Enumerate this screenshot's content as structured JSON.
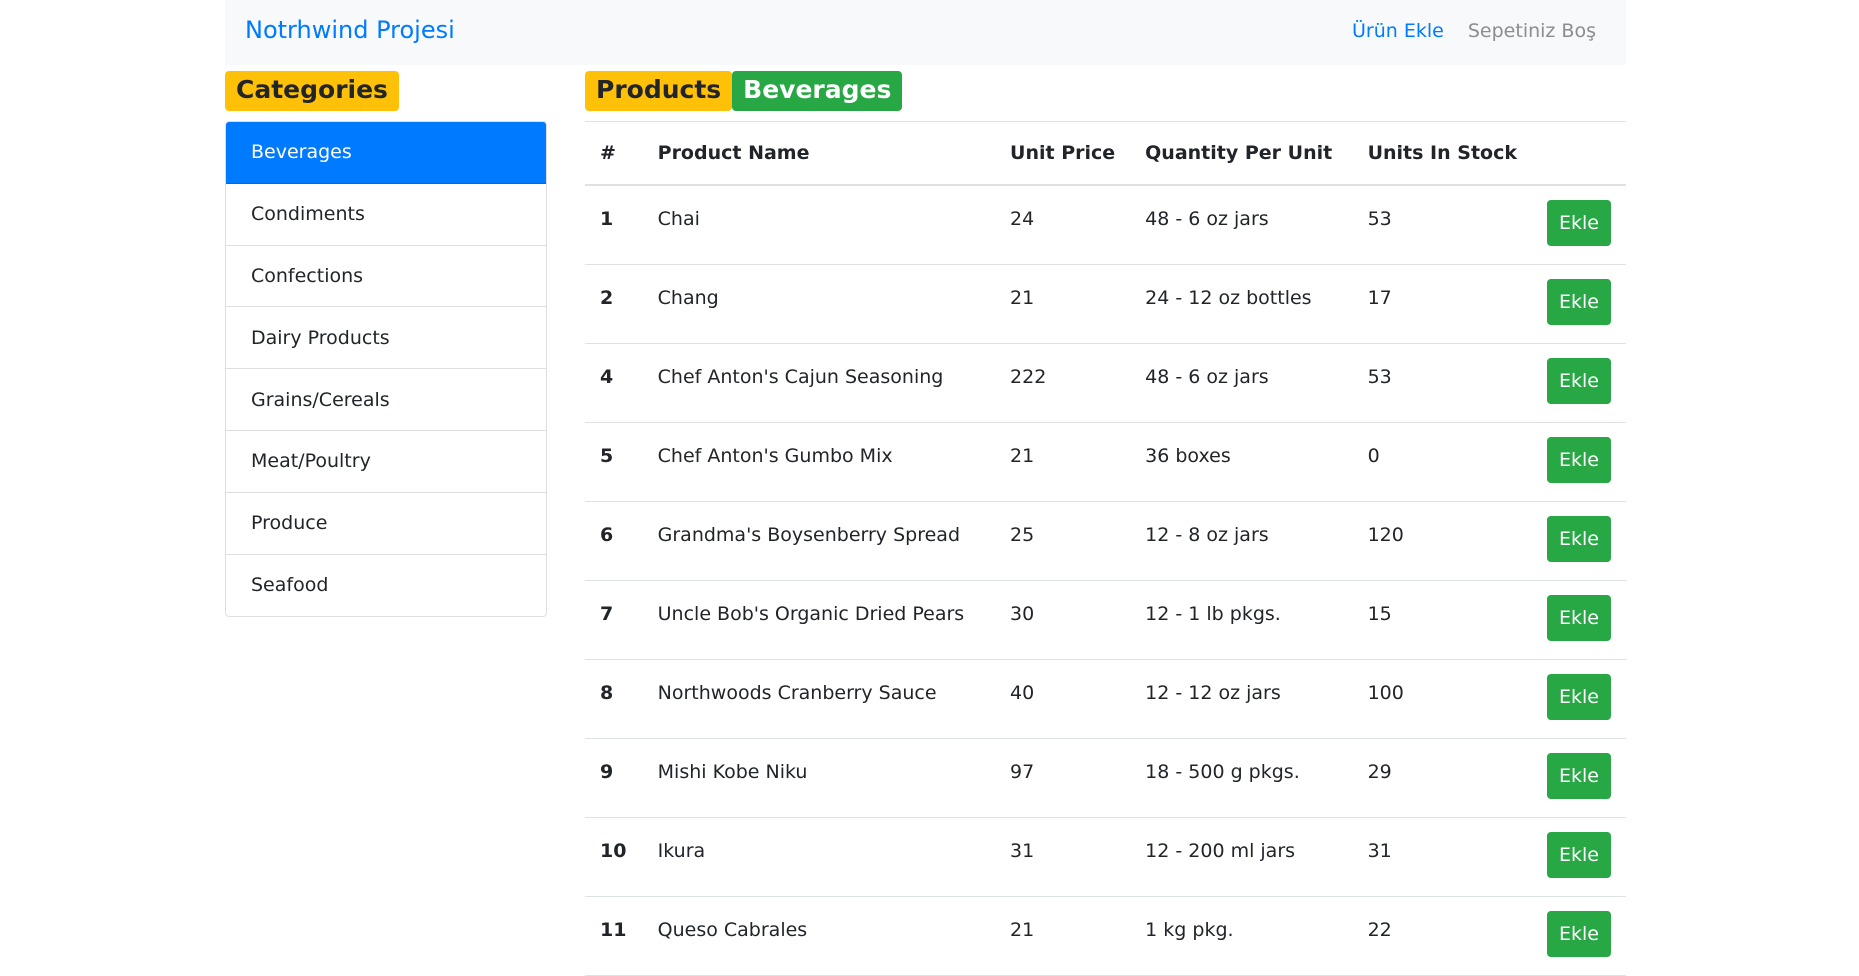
{
  "navbar": {
    "brand": "Notrhwind Projesi",
    "add_product": "Ürün Ekle",
    "cart_status": "Sepetiniz Boş"
  },
  "categories": {
    "title": "Categories",
    "items": [
      {
        "label": "Beverages",
        "active": true
      },
      {
        "label": "Condiments"
      },
      {
        "label": "Confections"
      },
      {
        "label": "Dairy Products"
      },
      {
        "label": "Grains/Cereals"
      },
      {
        "label": "Meat/Poultry"
      },
      {
        "label": "Produce"
      },
      {
        "label": "Seafood"
      }
    ]
  },
  "products": {
    "title": "Products",
    "current_category": "Beverages",
    "columns": [
      "#",
      "Product Name",
      "Unit Price",
      "Quantity Per Unit",
      "Units In Stock"
    ],
    "add_label": "Ekle",
    "rows": [
      {
        "id": "1",
        "name": "Chai",
        "price": "24",
        "qty": "48 - 6 oz jars",
        "stock": "53"
      },
      {
        "id": "2",
        "name": "Chang",
        "price": "21",
        "qty": "24 - 12 oz bottles",
        "stock": "17"
      },
      {
        "id": "4",
        "name": "Chef Anton's Cajun Seasoning",
        "price": "222",
        "qty": "48 - 6 oz jars",
        "stock": "53"
      },
      {
        "id": "5",
        "name": "Chef Anton's Gumbo Mix",
        "price": "21",
        "qty": "36 boxes",
        "stock": "0"
      },
      {
        "id": "6",
        "name": "Grandma's Boysenberry Spread",
        "price": "25",
        "qty": "12 - 8 oz jars",
        "stock": "120"
      },
      {
        "id": "7",
        "name": "Uncle Bob's Organic Dried Pears",
        "price": "30",
        "qty": "12 - 1 lb pkgs.",
        "stock": "15"
      },
      {
        "id": "8",
        "name": "Northwoods Cranberry Sauce",
        "price": "40",
        "qty": "12 - 12 oz jars",
        "stock": "100"
      },
      {
        "id": "9",
        "name": "Mishi Kobe Niku",
        "price": "97",
        "qty": "18 - 500 g pkgs.",
        "stock": "29"
      },
      {
        "id": "10",
        "name": "Ikura",
        "price": "31",
        "qty": "12 - 200 ml jars",
        "stock": "31"
      },
      {
        "id": "11",
        "name": "Queso Cabrales",
        "price": "21",
        "qty": "1 kg pkg.",
        "stock": "22"
      }
    ]
  },
  "colors": {
    "primary": "#007bff",
    "success": "#28a745",
    "warning": "#ffc107",
    "navbar_bg": "#f8f9fa"
  }
}
